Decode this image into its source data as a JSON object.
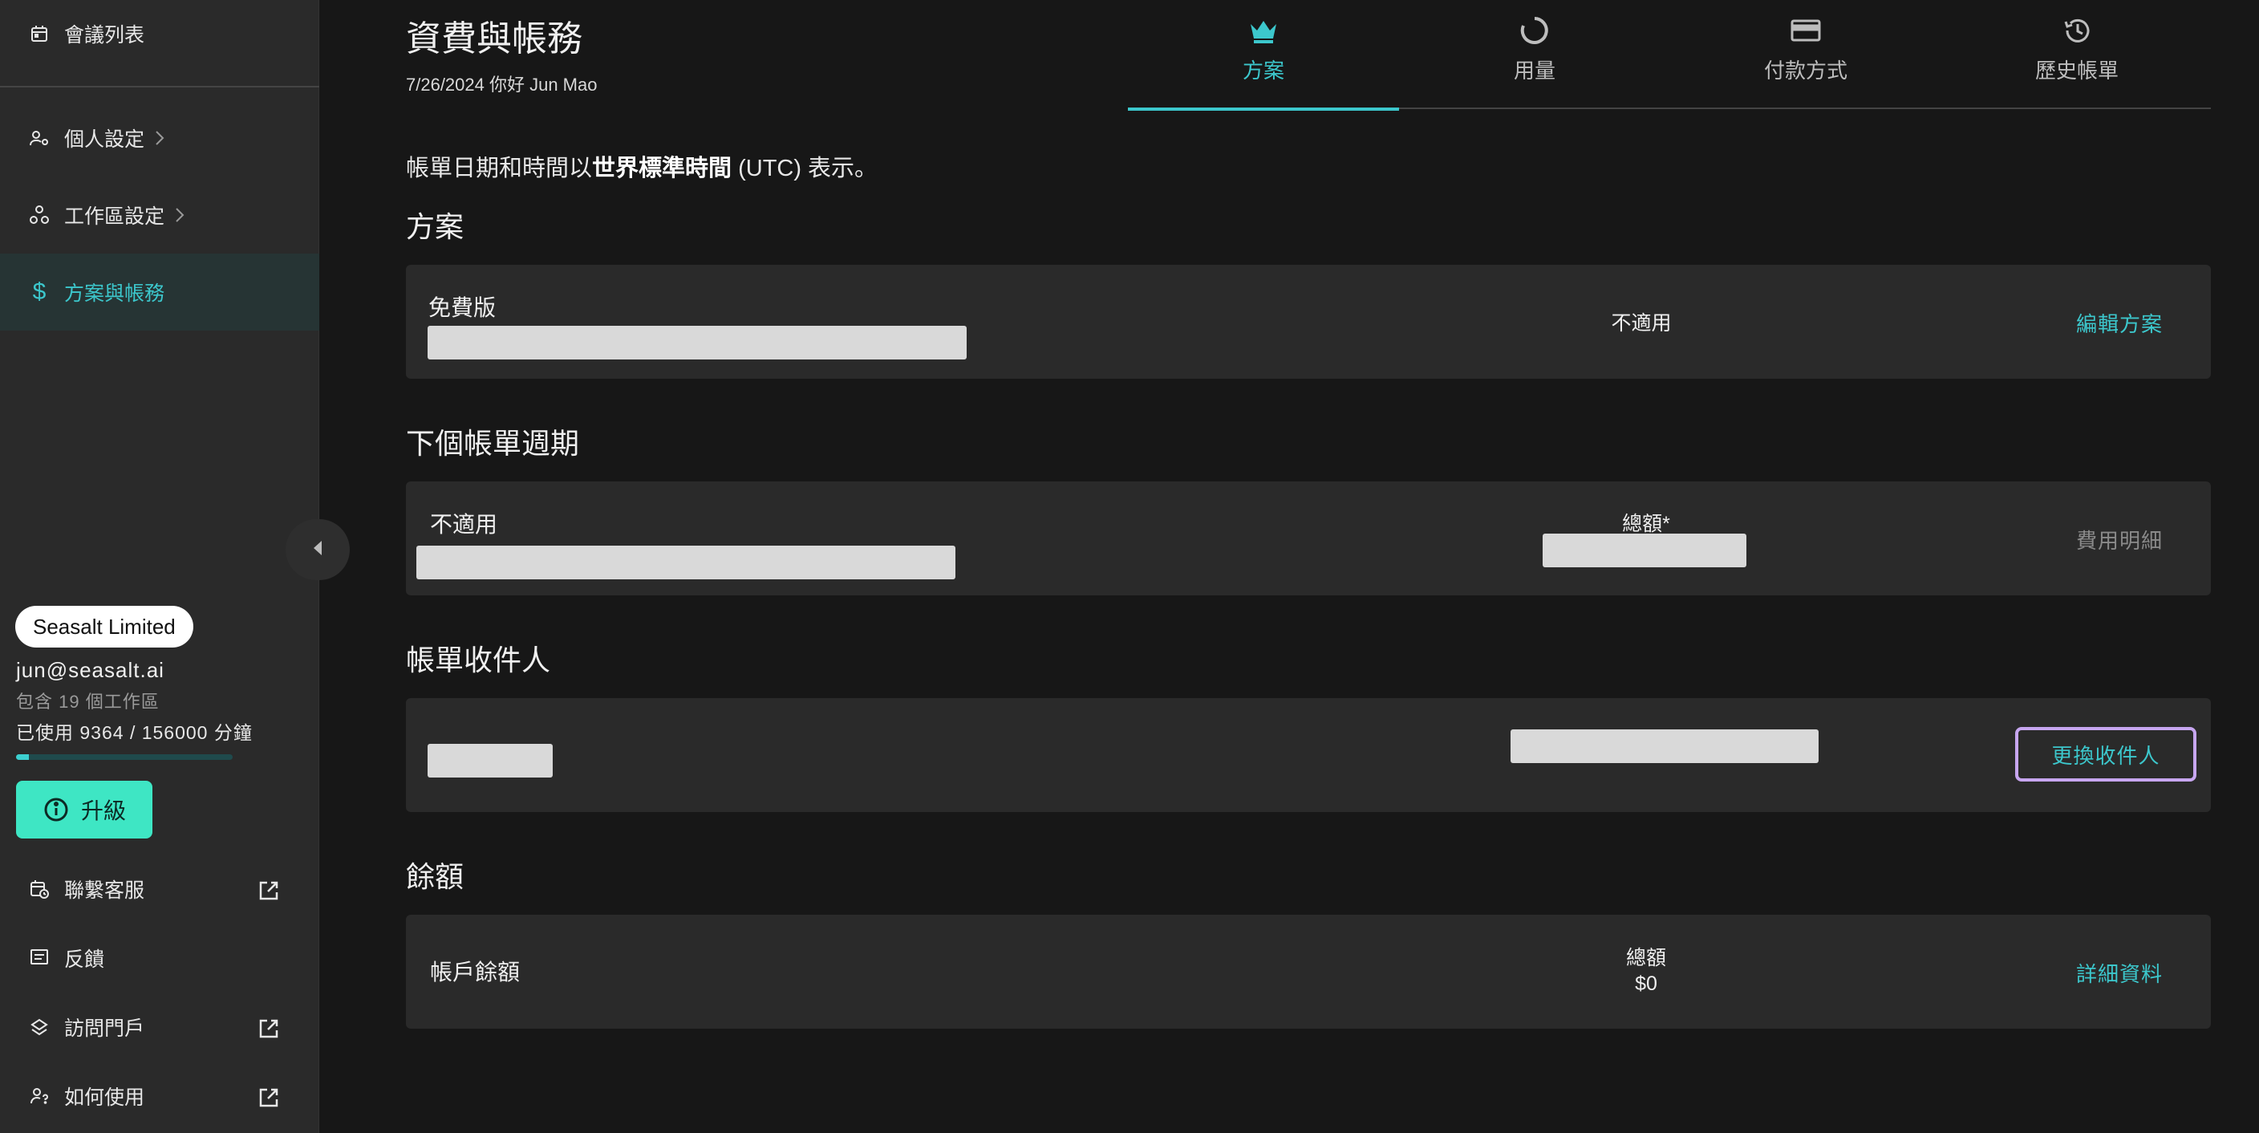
{
  "sidebar": {
    "items": [
      {
        "label": "會議列表"
      },
      {
        "label": "個人設定"
      },
      {
        "label": "工作區設定"
      },
      {
        "label": "方案與帳務"
      }
    ],
    "account": {
      "org": "Seasalt Limited",
      "email": "jun@seasalt.ai",
      "workspaces": "包含 19 個工作區",
      "usage": "已使用 9364 / 156000 分鐘",
      "usage_fraction": 0.06
    },
    "upgrade_label": "升級",
    "bottom": [
      {
        "label": "聯繫客服"
      },
      {
        "label": "反饋"
      },
      {
        "label": "訪問門戶"
      },
      {
        "label": "如何使用"
      }
    ]
  },
  "header": {
    "title": "資費與帳務",
    "subtitle": "7/26/2024 你好 Jun Mao"
  },
  "tabs": [
    {
      "label": "方案",
      "icon": "crown-icon",
      "active": true
    },
    {
      "label": "用量",
      "icon": "ring-icon"
    },
    {
      "label": "付款方式",
      "icon": "credit-card-icon"
    },
    {
      "label": "歷史帳單",
      "icon": "history-icon"
    }
  ],
  "notice": {
    "prefix": "帳單日期和時間以",
    "bold": "世界標準時間",
    "suffix": " (UTC) 表示。"
  },
  "plan": {
    "title": "方案",
    "name": "免費版",
    "status": "不適用",
    "action": "編輯方案"
  },
  "cycle": {
    "title": "下個帳單週期",
    "name": "不適用",
    "total_label": "總額*",
    "action": "費用明細"
  },
  "recipient": {
    "title": "帳單收件人",
    "action": "更換收件人"
  },
  "balance": {
    "title": "餘額",
    "name": "帳戶餘額",
    "total_label": "總額",
    "total_value": "$0",
    "action": "詳細資料"
  },
  "colors": {
    "accent": "#3cc7cc",
    "upgrade": "#3ee6c4",
    "focus_ring": "#c7a6f0"
  }
}
